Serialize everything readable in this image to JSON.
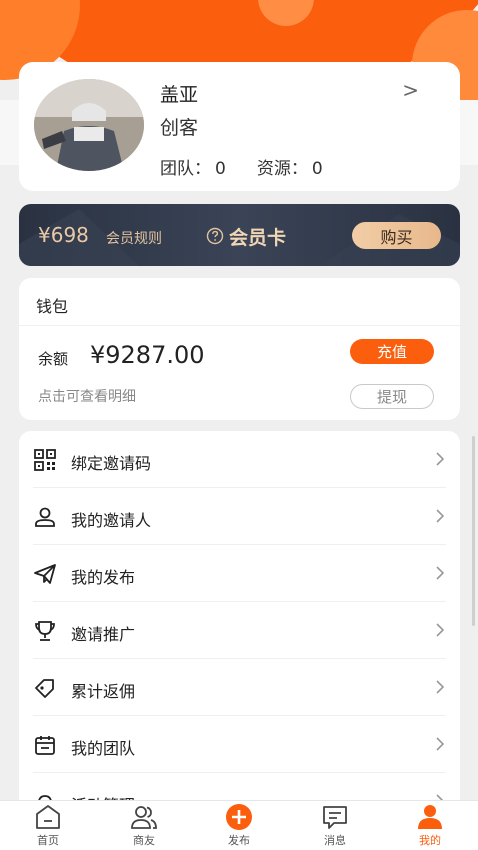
{
  "profile": {
    "name": "盖亚",
    "role": "创客",
    "team_label": "团队：",
    "team_count": "0",
    "resource_label": "资源：",
    "resource_count": "0",
    "arrow": ">"
  },
  "member_card": {
    "price": "¥698",
    "rules_label": "会员规则",
    "title": "会员卡",
    "buy_label": "购买"
  },
  "wallet": {
    "title": "钱包",
    "balance_label": "余额",
    "balance_value": "¥9287.00",
    "recharge_label": "充值",
    "detail_hint": "点击可查看明细",
    "withdraw_label": "提现"
  },
  "menu": {
    "items": [
      {
        "label": "绑定邀请码",
        "icon": "qr-code-icon"
      },
      {
        "label": "我的邀请人",
        "icon": "person-icon"
      },
      {
        "label": "我的发布",
        "icon": "paper-plane-icon"
      },
      {
        "label": "邀请推广",
        "icon": "trophy-icon"
      },
      {
        "label": "累计返佣",
        "icon": "tag-icon"
      },
      {
        "label": "我的团队",
        "icon": "calendar-icon"
      },
      {
        "label": "活动管理",
        "icon": "cloud-icon"
      }
    ]
  },
  "bottom_nav": {
    "items": [
      {
        "label": "首页",
        "icon": "home-icon"
      },
      {
        "label": "商友",
        "icon": "friends-icon"
      },
      {
        "label": "发布",
        "icon": "plus-circle-icon"
      },
      {
        "label": "消息",
        "icon": "message-icon"
      },
      {
        "label": "我的",
        "icon": "user-icon"
      }
    ],
    "active": "我的"
  },
  "colors": {
    "accent": "#fb5e0d",
    "card_dark": "#2f3848",
    "gold": "#e9c9a6"
  }
}
